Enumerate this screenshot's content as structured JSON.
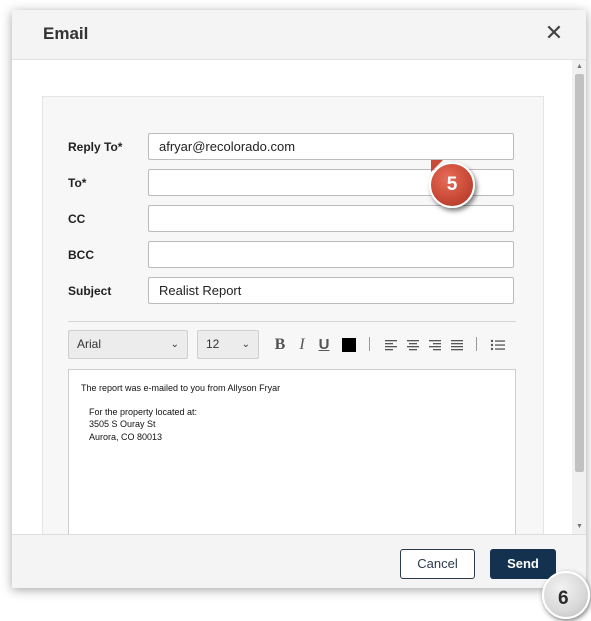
{
  "dialog": {
    "title": "Email",
    "close_glyph": "✕"
  },
  "form": {
    "reply_to": {
      "label": "Reply To*",
      "value": "afryar@recolorado.com"
    },
    "to": {
      "label": "To*",
      "value": ""
    },
    "cc": {
      "label": "CC",
      "value": ""
    },
    "bcc": {
      "label": "BCC",
      "value": ""
    },
    "subject": {
      "label": "Subject",
      "value": "Realist Report"
    }
  },
  "toolbar": {
    "font_family": "Arial",
    "font_size": "12",
    "bold": "B",
    "italic": "I",
    "underline": "U",
    "icons": [
      "font-color-icon",
      "align-left-icon",
      "align-center-icon",
      "align-right-icon",
      "align-justify-icon",
      "bullet-list-icon"
    ],
    "color_swatch": "#000000"
  },
  "editor": {
    "line1": "The report was e-mailed to you from Allyson Fryar",
    "line2": "For the property located at:",
    "line3": "3505 S Ouray St",
    "line4": "Aurora, CO 80013"
  },
  "footer": {
    "cancel_label": "Cancel",
    "send_label": "Send"
  },
  "callouts": {
    "step5": "5",
    "step6": "6"
  },
  "colors": {
    "primary": "#14324f",
    "callout_red": "#c94a37"
  }
}
